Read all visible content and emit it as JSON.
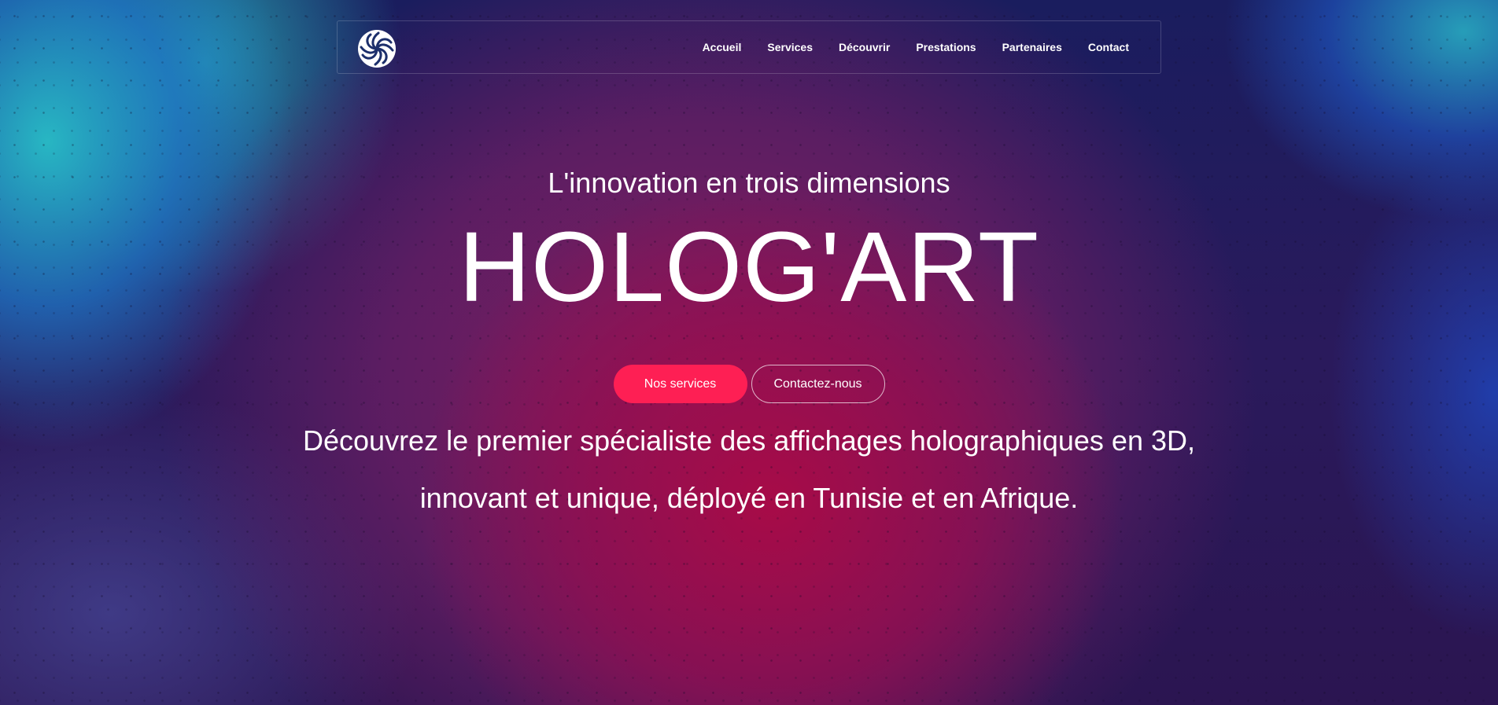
{
  "header": {
    "logo_icon": "swirl-logo-icon",
    "nav": [
      {
        "label": "Accueil"
      },
      {
        "label": "Services"
      },
      {
        "label": "Découvrir"
      },
      {
        "label": "Prestations"
      },
      {
        "label": "Partenaires"
      },
      {
        "label": "Contact"
      }
    ]
  },
  "hero": {
    "subtitle": "L'innovation en trois dimensions",
    "title": "HOLOG'ART",
    "primary_button": "Nos services",
    "secondary_button": "Contactez-nous",
    "description_line1": "Découvrez le premier spécialiste des affichages holographiques en 3D,",
    "description_line2": "innovant et unique, déployé en Tunisie et en Afrique."
  },
  "colors": {
    "accent": "#fe1f54",
    "text": "#ffffff"
  }
}
